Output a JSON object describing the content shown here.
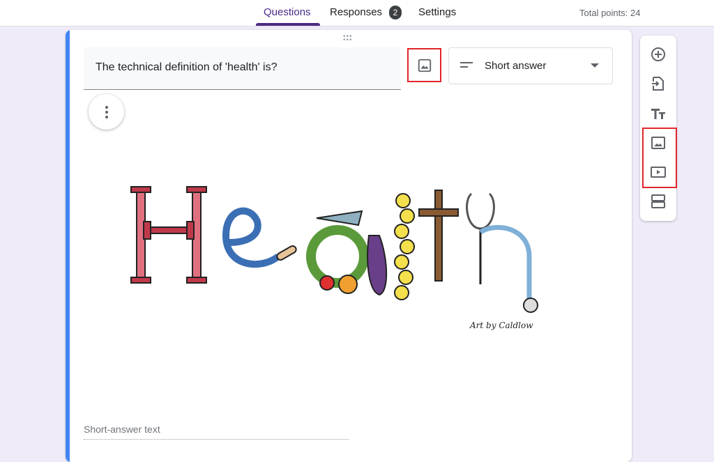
{
  "tabs": [
    {
      "label": "Questions",
      "active": true
    },
    {
      "label": "Responses",
      "badge": "2"
    },
    {
      "label": "Settings"
    }
  ],
  "total_points": "Total points: 24",
  "question": {
    "title": "The technical definition of 'health' is?",
    "type": "Short answer",
    "answer_placeholder": "Short-answer text"
  },
  "illustration": {
    "word": "Health",
    "signature": "Art by Caldlow"
  },
  "toolbar": {
    "items": [
      "add-question",
      "import-questions",
      "add-title-and-description",
      "add-image",
      "add-video",
      "add-section"
    ]
  },
  "colors": {
    "accent": "#4a2c85",
    "card_border": "#4285f4",
    "highlight": "#e0262b",
    "background": "#f0ebf8"
  }
}
